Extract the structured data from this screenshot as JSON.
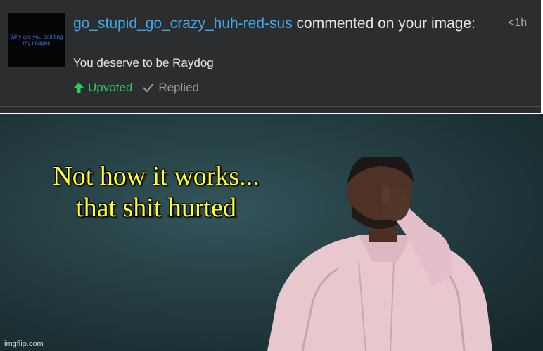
{
  "notification": {
    "avatar_text": "Why are you pointing my images",
    "username": "go_stupid_go_crazy_huh-red-sus",
    "action_text": " commented on your image:",
    "time": "<1h",
    "comment": "You deserve to be Raydog",
    "upvoted_label": "Upvoted",
    "replied_label": "Replied",
    "colors": {
      "username": "#3fa8e8",
      "upvoted": "#2fca5a",
      "panel_bg": "#2c2d2f"
    }
  },
  "meme": {
    "caption_line1": "Not how it works...",
    "caption_line2": "that shit hurted",
    "watermark": "imgflip.com",
    "caption_color": "#ffff33"
  }
}
